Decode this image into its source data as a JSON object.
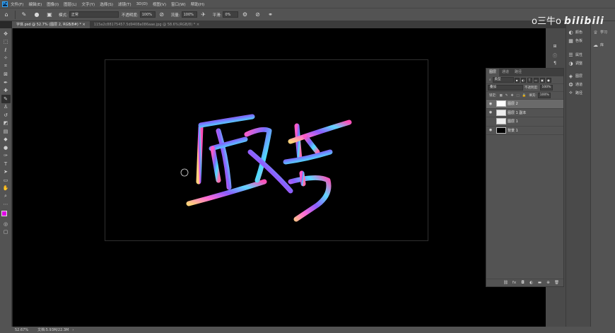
{
  "menubar": {
    "logo": "Ps",
    "items": [
      "文件(F)",
      "编辑(E)",
      "图像(I)",
      "图层(L)",
      "文字(Y)",
      "选择(S)",
      "滤镜(T)",
      "3D(D)",
      "视图(V)",
      "窗口(W)",
      "帮助(H)"
    ]
  },
  "options": {
    "mode_label": "模式:",
    "mode_value": "正常",
    "opacity_label": "不透明度:",
    "opacity_value": "100%",
    "flow_label": "流量:",
    "flow_value": "100%",
    "smoothing_label": "平滑:",
    "smoothing_value": "0%"
  },
  "tabs": [
    {
      "label": "字体.psd @ 52.7% (图层 2, RGB/8#) *  ×",
      "active": true
    },
    {
      "label": "115a2c88175457.5d9408a086aae.jpg @ 58.6%(RGB/8) *  ×",
      "active": false
    }
  ],
  "tools": [
    "move",
    "marquee",
    "lasso",
    "quick-select",
    "crop",
    "frame",
    "eyedropper",
    "healing",
    "brush",
    "clone-stamp",
    "history-brush",
    "eraser",
    "gradient",
    "blur",
    "dodge",
    "pen",
    "type",
    "path-select",
    "shape",
    "hand",
    "zoom",
    "more"
  ],
  "watermark": {
    "text": "o三牛o",
    "brand": "bilibili"
  },
  "dock": {
    "col1": [
      {
        "icon": "palette-icon",
        "label": "颜色"
      },
      {
        "icon": "swatches-icon",
        "label": "色板"
      },
      {
        "icon": "properties-icon",
        "label": "属性"
      },
      {
        "icon": "adjustments-icon",
        "label": "调整"
      },
      {
        "icon": "layers-icon",
        "label": "图层"
      },
      {
        "icon": "channels-icon",
        "label": "通道"
      },
      {
        "icon": "paths-icon",
        "label": "路径"
      }
    ],
    "col2": [
      {
        "icon": "learn-icon",
        "label": "学习"
      },
      {
        "icon": "libraries-icon",
        "label": "库"
      }
    ]
  },
  "layers_panel": {
    "tabs": [
      "图层",
      "通道",
      "路径"
    ],
    "filter_kind": "类型",
    "blend_mode": "叠加",
    "opacity_label": "不透明度:",
    "opacity_value": "100%",
    "lock_label": "锁定:",
    "fill_label": "填充:",
    "fill_value": "100%",
    "layers": [
      {
        "name": "图层 2",
        "visible": true,
        "selected": true
      },
      {
        "name": "图层 1 副本",
        "visible": true,
        "selected": false
      },
      {
        "name": "图层 1",
        "visible": false,
        "selected": false
      },
      {
        "name": "背景 1",
        "visible": true,
        "selected": false
      }
    ]
  },
  "status": {
    "zoom": "52.67%",
    "doc": "文档:5.93M/22.3M"
  }
}
